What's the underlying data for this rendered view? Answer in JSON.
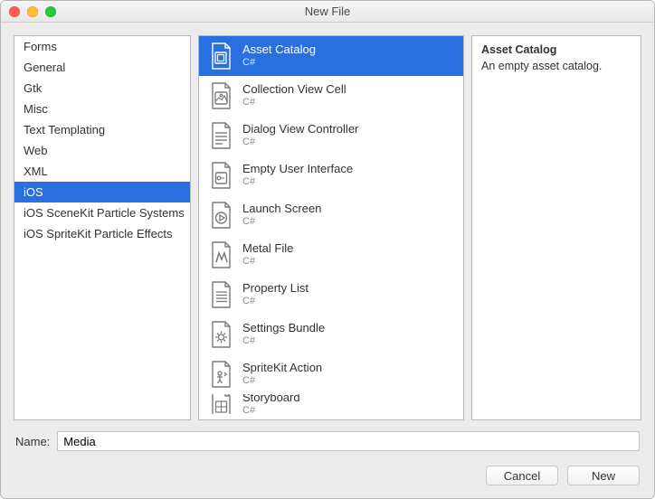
{
  "window": {
    "title": "New File"
  },
  "categories": {
    "items": [
      {
        "label": "Forms"
      },
      {
        "label": "General"
      },
      {
        "label": "Gtk"
      },
      {
        "label": "Misc"
      },
      {
        "label": "Text Templating"
      },
      {
        "label": "Web"
      },
      {
        "label": "XML"
      },
      {
        "label": "iOS"
      },
      {
        "label": "iOS SceneKit Particle Systems"
      },
      {
        "label": "iOS SpriteKit Particle Effects"
      }
    ],
    "selected_index": 7
  },
  "templates": {
    "items": [
      {
        "name": "Asset Catalog",
        "lang": "C#",
        "icon": "asset-catalog"
      },
      {
        "name": "Collection View Cell",
        "lang": "C#",
        "icon": "collection-view-cell"
      },
      {
        "name": "Dialog View Controller",
        "lang": "C#",
        "icon": "dialog-view-controller"
      },
      {
        "name": "Empty User Interface",
        "lang": "C#",
        "icon": "empty-ui"
      },
      {
        "name": "Launch Screen",
        "lang": "C#",
        "icon": "launch-screen"
      },
      {
        "name": "Metal File",
        "lang": "C#",
        "icon": "metal-file"
      },
      {
        "name": "Property List",
        "lang": "C#",
        "icon": "property-list"
      },
      {
        "name": "Settings Bundle",
        "lang": "C#",
        "icon": "settings-bundle"
      },
      {
        "name": "SpriteKit Action",
        "lang": "C#",
        "icon": "spritekit-action"
      },
      {
        "name": "Storyboard",
        "lang": "C#",
        "icon": "storyboard"
      }
    ],
    "selected_index": 0
  },
  "description": {
    "title": "Asset Catalog",
    "body": "An empty asset catalog."
  },
  "name_field": {
    "label": "Name:",
    "value": "Media"
  },
  "buttons": {
    "cancel": "Cancel",
    "new": "New"
  }
}
